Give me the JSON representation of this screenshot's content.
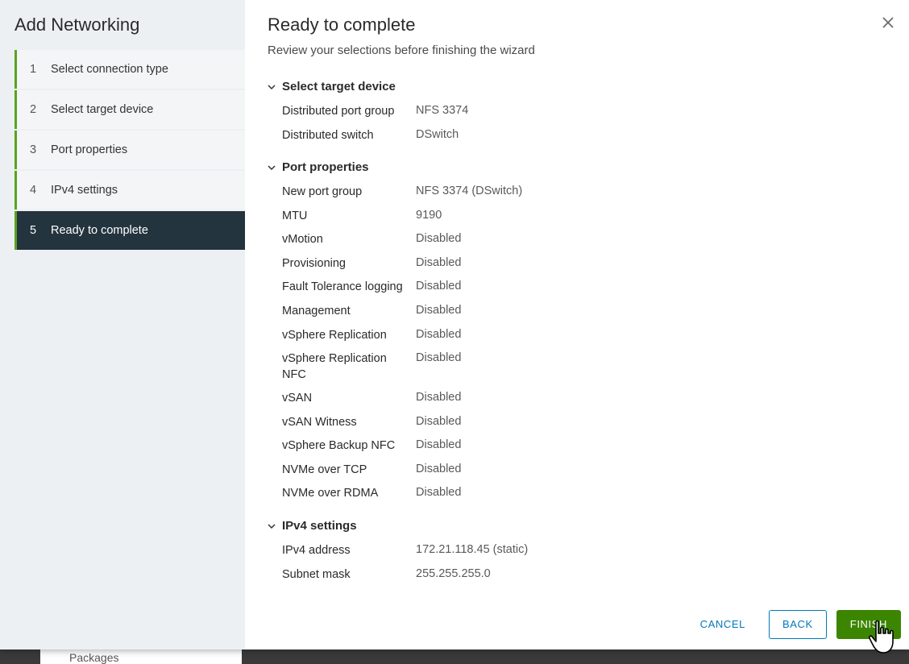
{
  "sidebar": {
    "title": "Add Networking",
    "steps": [
      {
        "num": "1",
        "label": "Select connection type"
      },
      {
        "num": "2",
        "label": "Select target device"
      },
      {
        "num": "3",
        "label": "Port properties"
      },
      {
        "num": "4",
        "label": "IPv4 settings"
      },
      {
        "num": "5",
        "label": "Ready to complete"
      }
    ]
  },
  "main": {
    "title": "Ready to complete",
    "subtitle": "Review your selections before finishing the wizard"
  },
  "sections": {
    "target": {
      "title": "Select target device",
      "rows": [
        {
          "label": "Distributed port group",
          "value": "NFS 3374"
        },
        {
          "label": "Distributed switch",
          "value": "DSwitch"
        }
      ]
    },
    "port": {
      "title": "Port properties",
      "rows": [
        {
          "label": "New port group",
          "value": "NFS 3374 (DSwitch)"
        },
        {
          "label": "MTU",
          "value": "9190"
        },
        {
          "label": "vMotion",
          "value": "Disabled"
        },
        {
          "label": "Provisioning",
          "value": "Disabled"
        },
        {
          "label": "Fault Tolerance logging",
          "value": "Disabled"
        },
        {
          "label": "Management",
          "value": "Disabled"
        },
        {
          "label": "vSphere Replication",
          "value": "Disabled"
        },
        {
          "label": "vSphere Replication NFC",
          "value": "Disabled"
        },
        {
          "label": "vSAN",
          "value": "Disabled"
        },
        {
          "label": "vSAN Witness",
          "value": "Disabled"
        },
        {
          "label": "vSphere Backup NFC",
          "value": "Disabled"
        },
        {
          "label": "NVMe over TCP",
          "value": "Disabled"
        },
        {
          "label": "NVMe over RDMA",
          "value": "Disabled"
        }
      ]
    },
    "ipv4": {
      "title": "IPv4 settings",
      "rows": [
        {
          "label": "IPv4 address",
          "value": "172.21.118.45 (static)"
        },
        {
          "label": "Subnet mask",
          "value": "255.255.255.0"
        }
      ]
    }
  },
  "footer": {
    "cancel": "CANCEL",
    "back": "BACK",
    "finish": "FINISH"
  },
  "backdrop": {
    "packages": "Packages"
  }
}
